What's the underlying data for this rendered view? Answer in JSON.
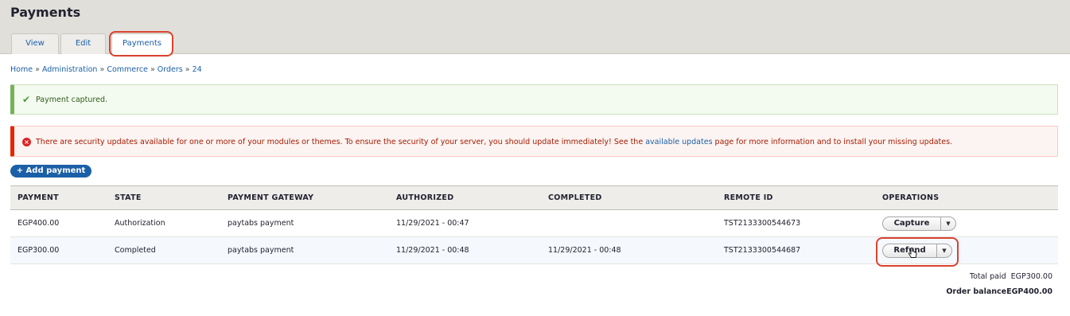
{
  "page": {
    "title": "Payments"
  },
  "tabs": [
    {
      "label": "View"
    },
    {
      "label": "Edit"
    },
    {
      "label": "Payments",
      "active": true
    }
  ],
  "breadcrumb": {
    "separator": "»",
    "items": [
      "Home",
      "Administration",
      "Commerce",
      "Orders",
      "24"
    ]
  },
  "messages": {
    "status": {
      "icon": "checkmark-icon",
      "text": "Payment captured."
    },
    "error": {
      "icon": "error-circle-icon",
      "text_before": "There are security updates available for one or more of your modules or themes. To ensure the security of your server, you should update immediately! See the ",
      "link": "available updates",
      "text_after": " page for more information and to install your missing updates."
    }
  },
  "add_payment_label": "+ Add payment",
  "table": {
    "headers": [
      "PAYMENT",
      "STATE",
      "PAYMENT GATEWAY",
      "AUTHORIZED",
      "COMPLETED",
      "REMOTE ID",
      "OPERATIONS"
    ],
    "rows": [
      {
        "payment": "EGP400.00",
        "state": "Authorization",
        "gateway": "paytabs payment",
        "authorized": "11/29/2021 - 00:47",
        "completed": "",
        "remote_id": "TST2133300544673",
        "operation": "Capture"
      },
      {
        "payment": "EGP300.00",
        "state": "Completed",
        "gateway": "paytabs payment",
        "authorized": "11/29/2021 - 00:48",
        "completed": "11/29/2021 - 00:48",
        "remote_id": "TST2133300544687",
        "operation": "Refund"
      }
    ]
  },
  "totals": {
    "paid_label": "Total paid",
    "paid_value": "EGP300.00",
    "balance_label": "Order balance",
    "balance_value": "EGP400.00"
  },
  "colors": {
    "link": "#1b5fa6",
    "highlight": "#d9432f",
    "status_green": "#77b259",
    "error_red": "#e62600"
  }
}
